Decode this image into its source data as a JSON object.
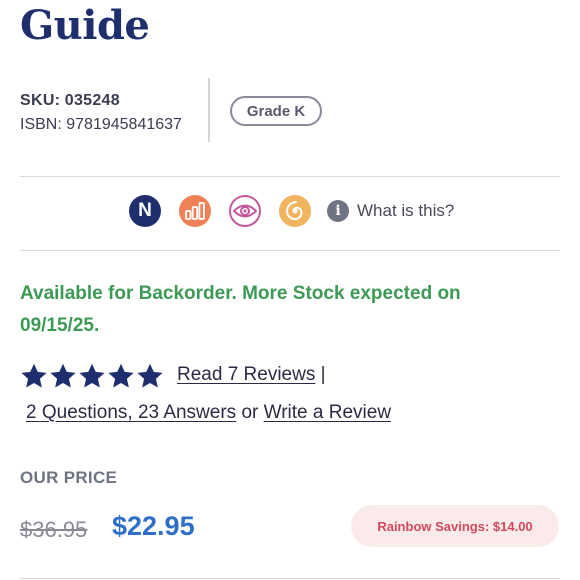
{
  "product": {
    "title": "Guide",
    "sku_label": "SKU:",
    "sku_value": "035248",
    "isbn_label": "ISBN:",
    "isbn_value": "9781945841637",
    "grade": "Grade K"
  },
  "badges": {
    "n_letter": "N",
    "info_glyph": "i",
    "info_text": "What is this?",
    "icons": [
      "n-badge-icon",
      "bar-chart-icon",
      "eye-icon",
      "spiral-icon",
      "info-icon"
    ],
    "colors": {
      "n": "#1f2f6e",
      "bars": "#ef8157",
      "eye": "#c35a9c",
      "spiral": "#f1b45f"
    }
  },
  "availability": "Available for Backorder. More Stock expected on 09/15/25.",
  "reviews": {
    "rating": 5,
    "read_reviews": "Read 7 Reviews",
    "sep": "|",
    "questions": "2 Questions, 23 Answers",
    "or": "or",
    "write": "Write a Review"
  },
  "pricing": {
    "label": "OUR PRICE",
    "original": "$36.95",
    "current": "$22.95",
    "savings": "Rainbow Savings: $14.00"
  }
}
